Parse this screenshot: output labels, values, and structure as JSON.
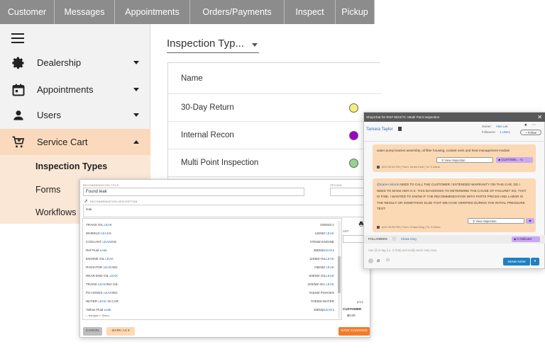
{
  "top_nav": [
    "Customer",
    "Messages",
    "Appointments",
    "Orders/Payments",
    "Inspect",
    "Pickup"
  ],
  "sidebar": {
    "items": [
      {
        "label": "Dealership",
        "icon": "gear-icon"
      },
      {
        "label": "Appointments",
        "icon": "calendar-icon"
      },
      {
        "label": "Users",
        "icon": "person-icon"
      },
      {
        "label": "Service Cart",
        "icon": "cart-icon"
      }
    ],
    "subitems": [
      "Inspection Types",
      "Forms",
      "Workflows"
    ]
  },
  "inspection": {
    "dropdown_label": "Inspection Typ...",
    "column_header": "Name",
    "rows": [
      {
        "name": "30-Day Return",
        "color": "#f5ef7b"
      },
      {
        "name": "Internal Recon",
        "color": "#a000c8"
      },
      {
        "name": "Multi Point Inspection",
        "color": "#92d68e"
      }
    ]
  },
  "modal": {
    "title_label": "RECOMMENDATION TITLE",
    "title_value": "Found leak",
    "opcode_label": "OPCODE",
    "desc_label": "RECOMMENDATION DESCRIPTION",
    "desc_value": "leak",
    "right_fragment": "ANT",
    "customer_label": "CUSTOMER",
    "customer_value": "$0.00",
    "price_label": "price",
    "list": [
      {
        "pre": "TRANS OIL ",
        "hit": "LEAK",
        "post": "",
        "code_pre": "2OEMZ-1",
        "code_hit": "",
        "code_post": ""
      },
      {
        "pre": "WHEELD ",
        "hit": "LEAK",
        "post": "S",
        "code_pre": "11EMZ ",
        "code_hit": "LEAK",
        "code_post": ""
      },
      {
        "pre": "COOLANT ",
        "hit": "LEAK",
        "post": "ING",
        "code_pre": "07EMZ-ENGINE",
        "code_hit": "",
        "code_post": ""
      },
      {
        "pre": "Ref Fluid ",
        "hit": "Leak",
        "post": "",
        "code_pre": "35EMZ",
        "code_hit": "LEAK",
        "code_post": "1"
      },
      {
        "pre": "ENGINE OIL ",
        "hit": "LEAK",
        "post": "",
        "code_pre": "11EMZ-OIL",
        "code_hit": "LEAK",
        "code_post": ""
      },
      {
        "pre": "RADIATOR ",
        "hit": "LEAK",
        "post": "ING",
        "code_pre": "03EMZ ",
        "code_hit": "LEAK",
        "code_post": ""
      },
      {
        "pre": "REAR END OIL ",
        "hit": "LEAK",
        "post": "",
        "code_pre": "83EMZ OIL",
        "code_hit": "LEAK",
        "code_post": ""
      },
      {
        "pre": "TRANS ",
        "hit": "LEAK",
        "post": "ING OIL",
        "code_pre": "2OEMZ-OIL ",
        "code_hit": "LEAK",
        "code_post": ""
      },
      {
        "pre": "PS HOSES ",
        "hit": "LEAK",
        "post": "ING",
        "code_pre": "#1EMZ PSHOES",
        "code_hit": "",
        "code_post": ""
      },
      {
        "pre": "WATER ",
        "hit": "LEAK",
        "post": " IN CAR",
        "code_pre": "7OEMZ-WATER",
        "code_hit": "",
        "code_post": ""
      },
      {
        "pre": "Yellow Fluid ",
        "hit": "Leak",
        "post": "",
        "code_pre": "33EMZ",
        "code_hit": "LEAK",
        "code_post": "1"
      }
    ],
    "list_footer": "↑↓ Navigate   ↵ Select",
    "cancel": "CANCEL",
    "mark_as": "MARK AS",
    "save": "SAVE CHANGES"
  },
  "chat": {
    "title": "ShopChat for RO# 9022/72 >Multi Point Inspection",
    "customer": "Tamara Taylor",
    "owner_label": "Owner:",
    "owner": "Alex Lok",
    "followers_label": "Followers:",
    "followers": "1 Users",
    "follow": "+ Follow",
    "msg1": "water pump bracket assembly, oil filter housing, coolant neck and heat management module",
    "view_inspection": "View Inspection",
    "customer_tag": "CUSTOME...",
    "tag_count": "+1",
    "meta1": "6/10 02:04 PM | From: Derek Kent | To: 3 Users",
    "msg2_mention": "@Karen Morris",
    "msg2": " NEED TO CALL THE CUSTOMER / EXTENDED WARRANTY ON THIS CAR, DO I NEED TO MAKE HER O.K. THIS DIAGNOSIS TO DETERMINE THE CAUSE OF FAILURE? SO, THAT IS FINE, I WANTED TO KNOW IF THE RECOMMENDATION WITH PARTS PRICES AND LABOR IS THE RESULT OR SOMETHING ELSE THAT WE HAVE VERIFIED DURING THE INITIAL PRESSURE TEST.",
    "meta2": "6/10 03:26 PM | From: Chase King | To: 3 Users",
    "followers_bar": "FOLLOWERS",
    "follower_name": "Chase King",
    "attributes": "0 Attributes",
    "input_placeholder": "Use @ to tag (i.e. 3 chat) and notify users only once",
    "send": "SEND NOW",
    "colors": {
      "header": "#595959",
      "msg": "#fbd9b5",
      "pill": "#c9a9f0",
      "send": "#1e7fc7"
    }
  }
}
